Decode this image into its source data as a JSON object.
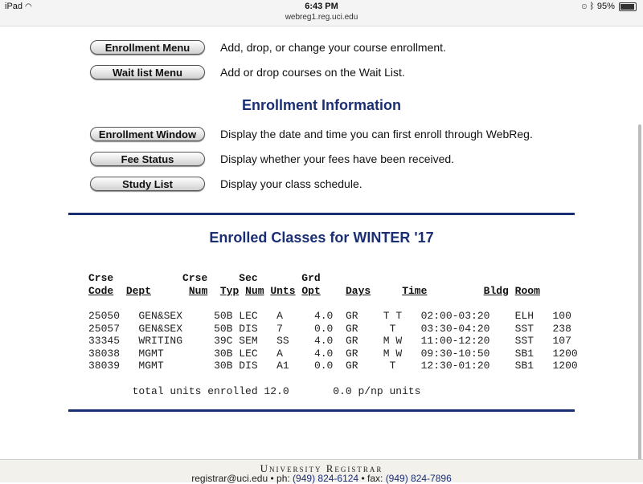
{
  "statusbar": {
    "device": "iPad",
    "time": "6:43 PM",
    "url": "webreg1.reg.uci.edu",
    "battery": "95%",
    "battery_level": 0.95
  },
  "menu": [
    {
      "label": "Enrollment Menu",
      "desc": "Add, drop, or change your course enrollment."
    },
    {
      "label": "Wait list Menu",
      "desc": "Add or drop courses on the Wait List."
    }
  ],
  "info_heading": "Enrollment Information",
  "info": [
    {
      "label": "Enrollment Window",
      "desc": "Display the date and time you can first enroll through WebReg."
    },
    {
      "label": "Fee Status",
      "desc": "Display whether your fees have been received."
    },
    {
      "label": "Study List",
      "desc": "Display your class schedule."
    }
  ],
  "enrolled": {
    "title": "Enrolled Classes for WINTER '17",
    "header_top": {
      "crse": "Crse",
      "crse_num": "Crse",
      "sec": "Sec",
      "grd": "Grd"
    },
    "header_bottom": {
      "code": "Code",
      "dept": "Dept",
      "num": "Num",
      "typ": "Typ",
      "sec_num": "Num",
      "unts": "Unts",
      "opt": "Opt",
      "days": "Days",
      "time": "Time",
      "bldg": "Bldg",
      "room": "Room"
    },
    "rows": [
      [
        "25050",
        "GEN&SEX",
        "50B",
        "LEC",
        "A",
        "4.0",
        "GR",
        "T T",
        "02:00-03:20",
        "ELH",
        "100"
      ],
      [
        "25057",
        "GEN&SEX",
        "50B",
        "DIS",
        "7",
        "0.0",
        "GR",
        "T",
        "03:30-04:20",
        "SST",
        "238"
      ],
      [
        "33345",
        "WRITING",
        "39C",
        "SEM",
        "SS",
        "4.0",
        "GR",
        "M W",
        "11:00-12:20",
        "SST",
        "107"
      ],
      [
        "38038",
        "MGMT",
        "30B",
        "LEC",
        "A",
        "4.0",
        "GR",
        "M W",
        "09:30-10:50",
        "SB1",
        "1200"
      ],
      [
        "38039",
        "MGMT",
        "30B",
        "DIS",
        "A1",
        "0.0",
        "GR",
        "T",
        "12:30-01:20",
        "SB1",
        "1200"
      ]
    ],
    "total_units": "total units enrolled 12.0",
    "pnp_units": "0.0 p/np units"
  },
  "footer": {
    "title": "University Registrar",
    "email": "registrar@uci.edu",
    "sep1": "•",
    "ph_label": "ph:",
    "phone": "(949) 824-6124",
    "sep2": "•",
    "fax_label": "fax:",
    "fax": "(949) 824-7896"
  }
}
